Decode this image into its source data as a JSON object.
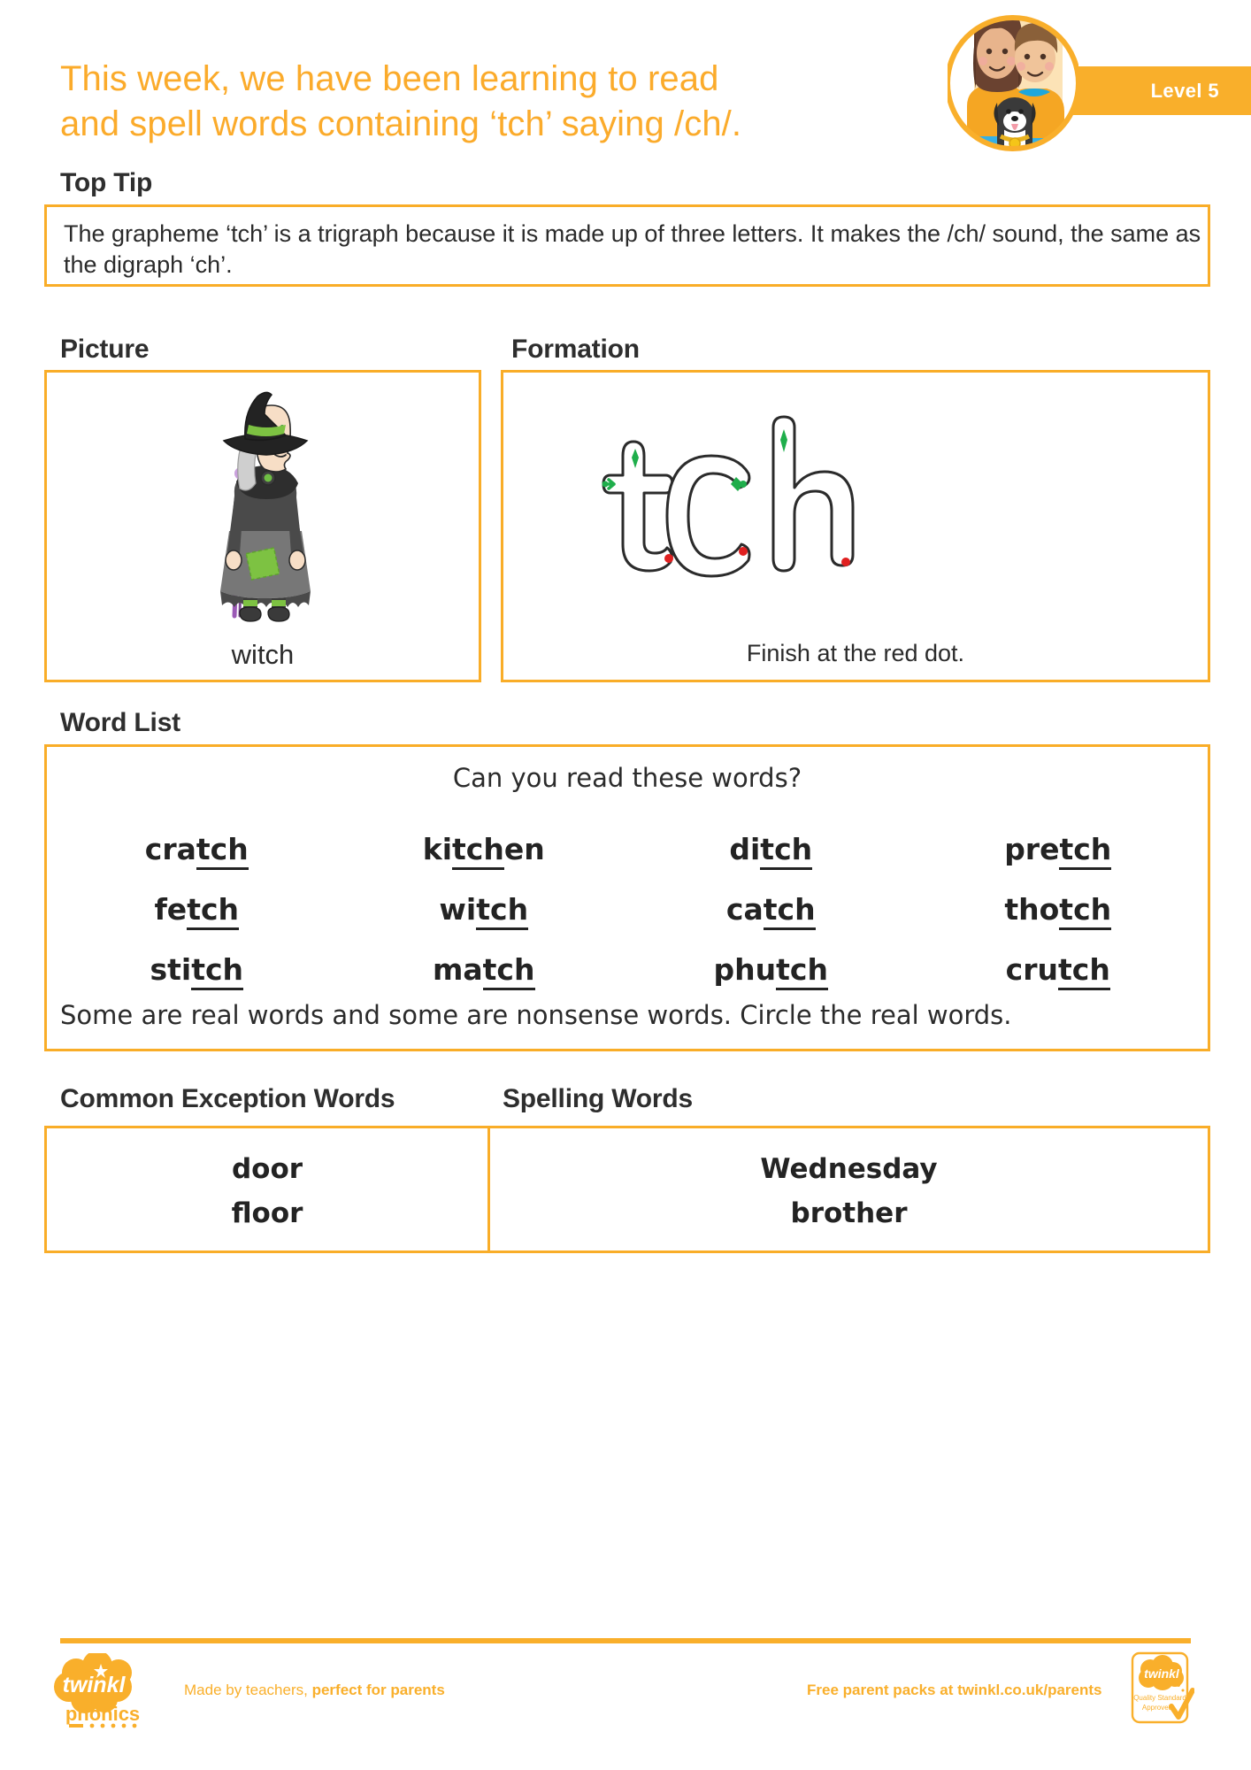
{
  "header": {
    "title_line1": "This week, we have been learning to read",
    "title_line2": "and spell words containing ‘tch’ saying /ch/.",
    "level_label": "Level 5",
    "accent_color": "#F9AF2B",
    "badge_icon": "children-with-dog-icon"
  },
  "top_tip": {
    "heading": "Top Tip",
    "body": "The grapheme ‘tch’ is a trigraph because it is made up of three letters. It makes the /ch/ sound, the same as the digraph ‘ch’."
  },
  "picture": {
    "heading": "Picture",
    "caption": "witch",
    "icon": "witch-illustration-icon"
  },
  "formation": {
    "heading": "Formation",
    "letters": "tch",
    "caption": "Finish at the red dot.",
    "start_marker_color": "#22B04B",
    "end_marker_color": "#E02020"
  },
  "word_list": {
    "heading": "Word List",
    "prompt": "Can you read these words?",
    "footer": "Some are real words and some are nonsense words. Circle the real words.",
    "rows": [
      [
        {
          "prefix": "cra",
          "grapheme": "tch",
          "suffix": ""
        },
        {
          "prefix": "ki",
          "grapheme": "tch",
          "suffix": "en"
        },
        {
          "prefix": "di",
          "grapheme": "tch",
          "suffix": ""
        },
        {
          "prefix": "pre",
          "grapheme": "tch",
          "suffix": ""
        }
      ],
      [
        {
          "prefix": "fe",
          "grapheme": "tch",
          "suffix": ""
        },
        {
          "prefix": "wi",
          "grapheme": "tch",
          "suffix": ""
        },
        {
          "prefix": "ca",
          "grapheme": "tch",
          "suffix": ""
        },
        {
          "prefix": "tho",
          "grapheme": "tch",
          "suffix": ""
        }
      ],
      [
        {
          "prefix": "sti",
          "grapheme": "tch",
          "suffix": ""
        },
        {
          "prefix": "ma",
          "grapheme": "tch",
          "suffix": ""
        },
        {
          "prefix": "phu",
          "grapheme": "tch",
          "suffix": ""
        },
        {
          "prefix": "cru",
          "grapheme": "tch",
          "suffix": ""
        }
      ]
    ]
  },
  "common_exception_words": {
    "heading": "Common Exception Words",
    "words": [
      "door",
      "floor"
    ]
  },
  "spelling_words": {
    "heading": "Spelling Words",
    "words": [
      "Wednesday",
      "brother"
    ]
  },
  "footer": {
    "logo_main": "twinkl",
    "logo_sub": "phonics",
    "made_plain": "Made by teachers, ",
    "made_bold": "perfect for parents",
    "packs": "Free parent packs at twinkl.co.uk/parents",
    "badge_title": "twinkl",
    "badge_line1": "Quality Standard",
    "badge_line2": "Approved"
  }
}
